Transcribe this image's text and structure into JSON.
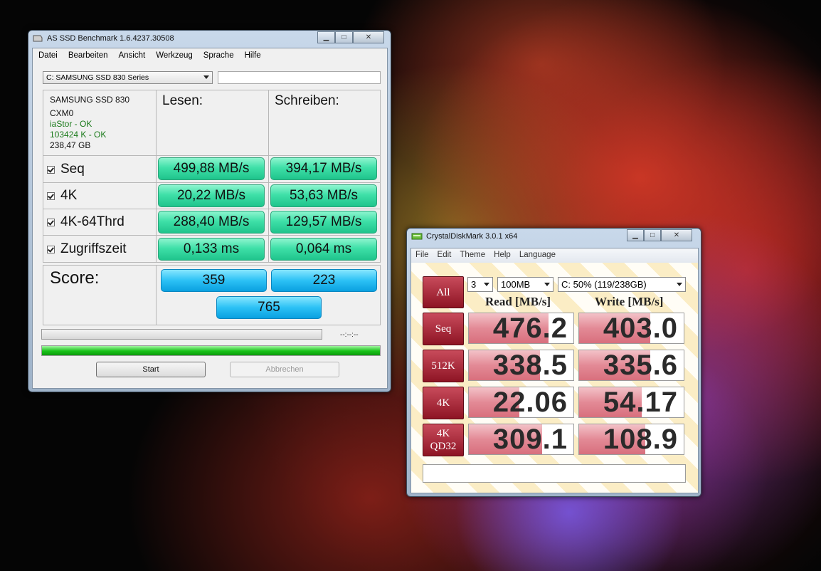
{
  "as_ssd": {
    "title": "AS SSD Benchmark 1.6.4237.30508",
    "window_buttons": {
      "minimize": "▁",
      "maximize": "□",
      "close": "✕"
    },
    "menu": [
      "Datei",
      "Bearbeiten",
      "Ansicht",
      "Werkzeug",
      "Sprache",
      "Hilfe"
    ],
    "drive_select": "C: SAMSUNG SSD 830 Series",
    "drive_info": {
      "model": "SAMSUNG SSD 830",
      "firmware": "CXM0",
      "driver": "iaStor - OK",
      "alignment": "103424 K - OK",
      "size": "238,47 GB"
    },
    "headers": {
      "read": "Lesen:",
      "write": "Schreiben:"
    },
    "rows": [
      {
        "label": "Seq",
        "read": "499,88 MB/s",
        "write": "394,17 MB/s",
        "checked": true
      },
      {
        "label": "4K",
        "read": "20,22 MB/s",
        "write": "53,63 MB/s",
        "checked": true
      },
      {
        "label": "4K-64Thrd",
        "read": "288,40 MB/s",
        "write": "129,57 MB/s",
        "checked": true
      },
      {
        "label": "Zugriffszeit",
        "read": "0,133 ms",
        "write": "0,064 ms",
        "checked": true
      }
    ],
    "score": {
      "label": "Score:",
      "read": "359",
      "write": "223",
      "total": "765"
    },
    "time_display": "--:--:--",
    "total_progress": 1.0,
    "buttons": {
      "start": "Start",
      "abort": "Abbrechen"
    }
  },
  "cdm": {
    "title": "CrystalDiskMark 3.0.1 x64",
    "window_buttons": {
      "minimize": "▁",
      "maximize": "□",
      "close": "✕"
    },
    "menu": [
      "File",
      "Edit",
      "Theme",
      "Help",
      "Language"
    ],
    "all_button": "All",
    "count_select": "3",
    "size_select": "100MB",
    "drive_select": "C: 50% (119/238GB)",
    "headers": {
      "read": "Read [MB/s]",
      "write": "Write [MB/s]"
    },
    "rows": [
      {
        "label": "Seq",
        "read": "476.2",
        "write": "403.0",
        "read_fill": 0.76,
        "write_fill": 0.68
      },
      {
        "label": "512K",
        "read": "338.5",
        "write": "335.6",
        "read_fill": 0.68,
        "write_fill": 0.68
      },
      {
        "label": "4K",
        "read": "22.06",
        "write": "54.17",
        "read_fill": 0.48,
        "write_fill": 0.6
      },
      {
        "label": "4K QD32",
        "read": "309.1",
        "write": "108.9",
        "read_fill": 0.7,
        "write_fill": 0.63
      }
    ]
  }
}
